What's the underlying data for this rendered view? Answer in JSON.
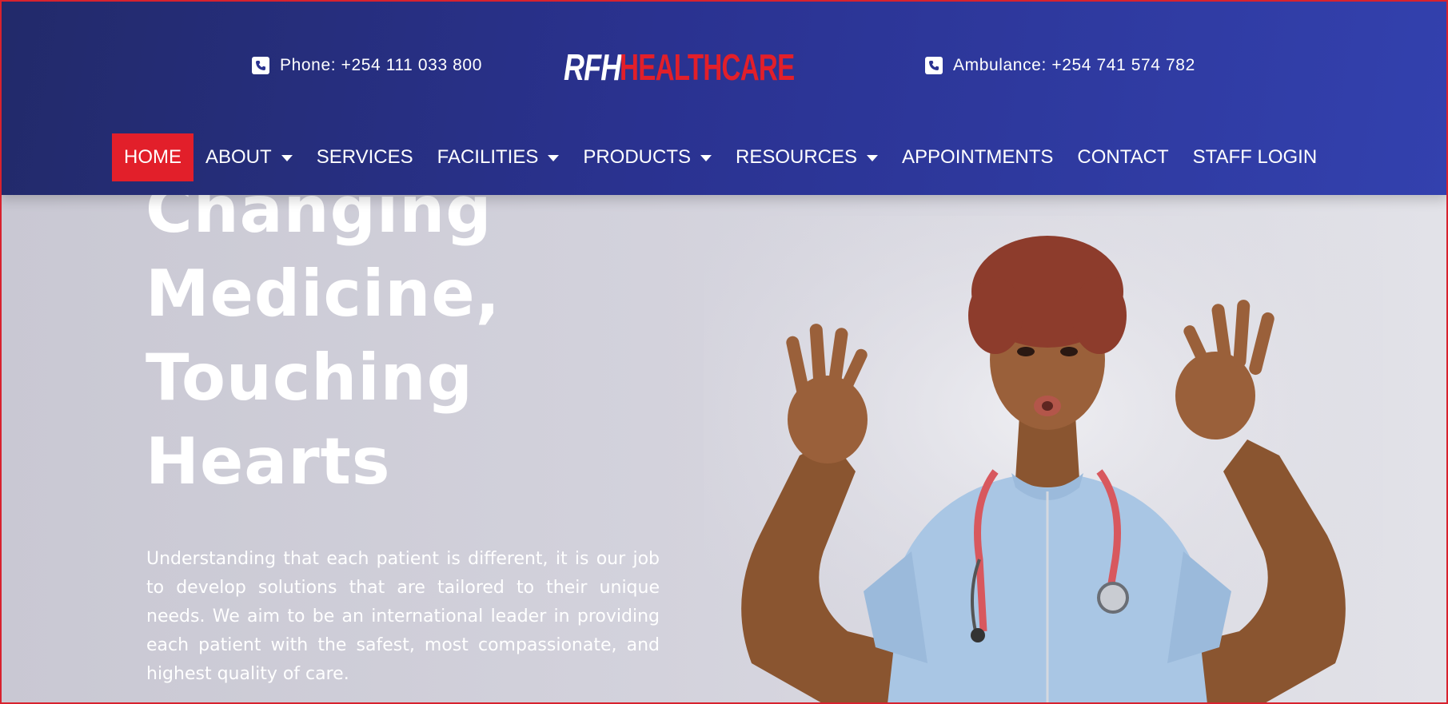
{
  "header": {
    "phone_text": "Phone: +254 111 033 800",
    "ambulance_text": "Ambulance: +254 741 574 782",
    "logo": {
      "left_text": "RFH",
      "right_text": "HEALTHCARE"
    },
    "nav": [
      {
        "label": "HOME",
        "active": true,
        "dropdown": false
      },
      {
        "label": "ABOUT",
        "active": false,
        "dropdown": true
      },
      {
        "label": "SERVICES",
        "active": false,
        "dropdown": false
      },
      {
        "label": "FACILITIES",
        "active": false,
        "dropdown": true
      },
      {
        "label": "PRODUCTS",
        "active": false,
        "dropdown": true
      },
      {
        "label": "RESOURCES",
        "active": false,
        "dropdown": true
      },
      {
        "label": "APPOINTMENTS",
        "active": false,
        "dropdown": false
      },
      {
        "label": "CONTACT",
        "active": false,
        "dropdown": false
      },
      {
        "label": "STAFF LOGIN",
        "active": false,
        "dropdown": false
      }
    ]
  },
  "hero": {
    "headline_lines": [
      "Changing",
      "Medicine,",
      "Touching",
      "Hearts"
    ],
    "intro": "Understanding that each patient is different, it is our job to develop solutions that are tailored to their unique needs. We aim to be an international leader in providing each patient with the safest, most compassionate, and highest quality of care."
  },
  "colors": {
    "header_dark": "#222a6a",
    "header_light": "#3341ae",
    "accent_red": "#e21f2a",
    "hero_bg": "#d3d2dc"
  },
  "icons": [
    "phone-icon",
    "phone-icon",
    "cross-badge-icon",
    "chevron-down-icon"
  ]
}
